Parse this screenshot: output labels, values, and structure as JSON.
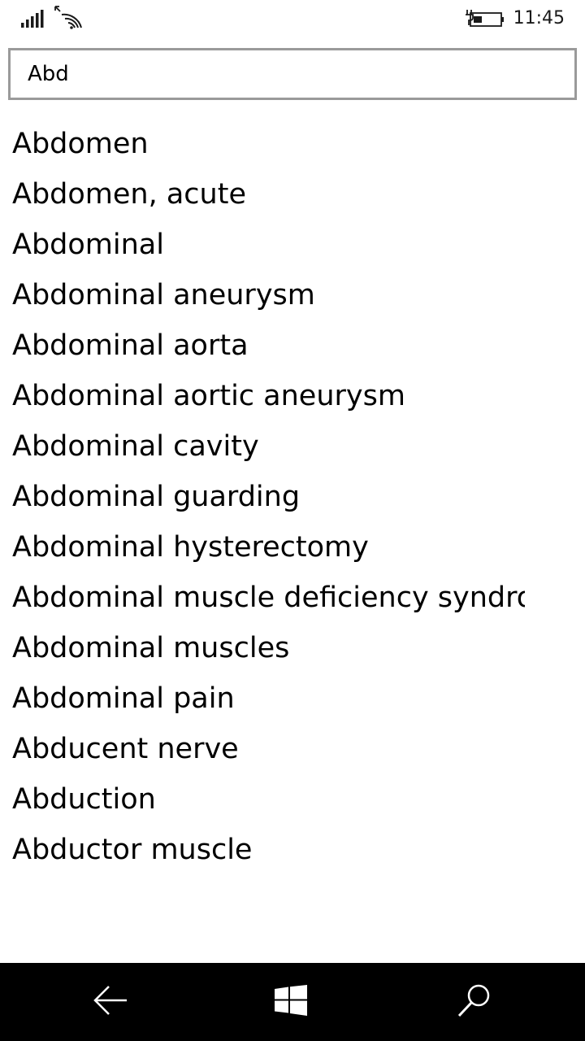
{
  "status_bar": {
    "time": "11:45",
    "icons": [
      "signal-strength-icon",
      "wifi-icon",
      "battery-charging-icon"
    ]
  },
  "search": {
    "value": "Abd"
  },
  "results": [
    "Abdomen",
    "Abdomen, acute",
    "Abdominal",
    "Abdominal aneurysm",
    "Abdominal aorta",
    "Abdominal aortic aneurysm",
    "Abdominal cavity",
    "Abdominal guarding",
    "Abdominal hysterectomy",
    "Abdominal muscle deficiency syndrome",
    "Abdominal muscles",
    "Abdominal pain",
    "Abducent nerve",
    "Abduction",
    "Abductor muscle"
  ],
  "nav_bar": {
    "icons": [
      "back-arrow-icon",
      "windows-logo-icon",
      "search-icon"
    ],
    "background": "#000000"
  }
}
